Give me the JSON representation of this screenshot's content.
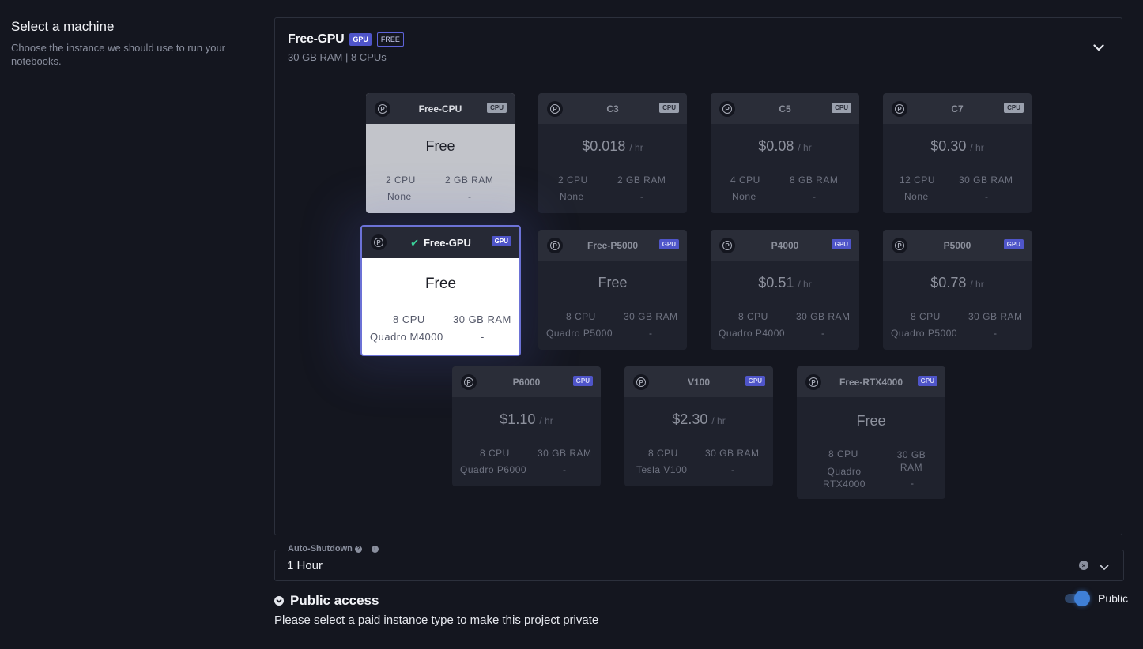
{
  "left": {
    "title": "Select a machine",
    "description": "Choose the instance we should use to run your notebooks."
  },
  "selected": {
    "name": "Free-GPU",
    "gpu_chip": "GPU",
    "free_chip": "FREE",
    "specs": "30 GB RAM  |  8 CPUs"
  },
  "machines": [
    {
      "name": "Free-CPU",
      "type": "CPU",
      "price": "Free",
      "unit": "",
      "cpu": "2 CPU",
      "ram": "2 GB RAM",
      "gpu": "None",
      "extra": "-"
    },
    {
      "name": "C3",
      "type": "CPU",
      "price": "$0.018",
      "unit": "/ hr",
      "cpu": "2 CPU",
      "ram": "2 GB RAM",
      "gpu": "None",
      "extra": "-"
    },
    {
      "name": "C5",
      "type": "CPU",
      "price": "$0.08",
      "unit": "/ hr",
      "cpu": "4 CPU",
      "ram": "8 GB RAM",
      "gpu": "None",
      "extra": "-"
    },
    {
      "name": "C7",
      "type": "CPU",
      "price": "$0.30",
      "unit": "/ hr",
      "cpu": "12 CPU",
      "ram": "30 GB RAM",
      "gpu": "None",
      "extra": "-"
    },
    {
      "name": "Free-GPU",
      "type": "GPU",
      "price": "Free",
      "unit": "",
      "cpu": "8 CPU",
      "ram": "30 GB RAM",
      "gpu": "Quadro M4000",
      "extra": "-"
    },
    {
      "name": "Free-P5000",
      "type": "GPU",
      "price": "Free",
      "unit": "",
      "cpu": "8 CPU",
      "ram": "30 GB RAM",
      "gpu": "Quadro P5000",
      "extra": "-"
    },
    {
      "name": "P4000",
      "type": "GPU",
      "price": "$0.51",
      "unit": "/ hr",
      "cpu": "8 CPU",
      "ram": "30 GB RAM",
      "gpu": "Quadro P4000",
      "extra": "-"
    },
    {
      "name": "P5000",
      "type": "GPU",
      "price": "$0.78",
      "unit": "/ hr",
      "cpu": "8 CPU",
      "ram": "30 GB RAM",
      "gpu": "Quadro P5000",
      "extra": "-"
    },
    {
      "name": "P6000",
      "type": "GPU",
      "price": "$1.10",
      "unit": "/ hr",
      "cpu": "8 CPU",
      "ram": "30 GB RAM",
      "gpu": "Quadro P6000",
      "extra": "-"
    },
    {
      "name": "V100",
      "type": "GPU",
      "price": "$2.30",
      "unit": "/ hr",
      "cpu": "8 CPU",
      "ram": "30 GB RAM",
      "gpu": "Tesla V100",
      "extra": "-"
    },
    {
      "name": "Free-RTX4000",
      "type": "GPU",
      "price": "Free",
      "unit": "",
      "cpu": "8 CPU",
      "ram": "30 GB RAM",
      "gpu": "Quadro RTX4000",
      "extra": "-"
    }
  ],
  "logo_letter": "P",
  "check_glyph": "✔",
  "shutdown": {
    "label": "Auto-Shutdown",
    "value": "1 Hour"
  },
  "access": {
    "title": "Public access",
    "note": "Please select a paid instance type to make this project private",
    "toggle_label": "Public"
  }
}
